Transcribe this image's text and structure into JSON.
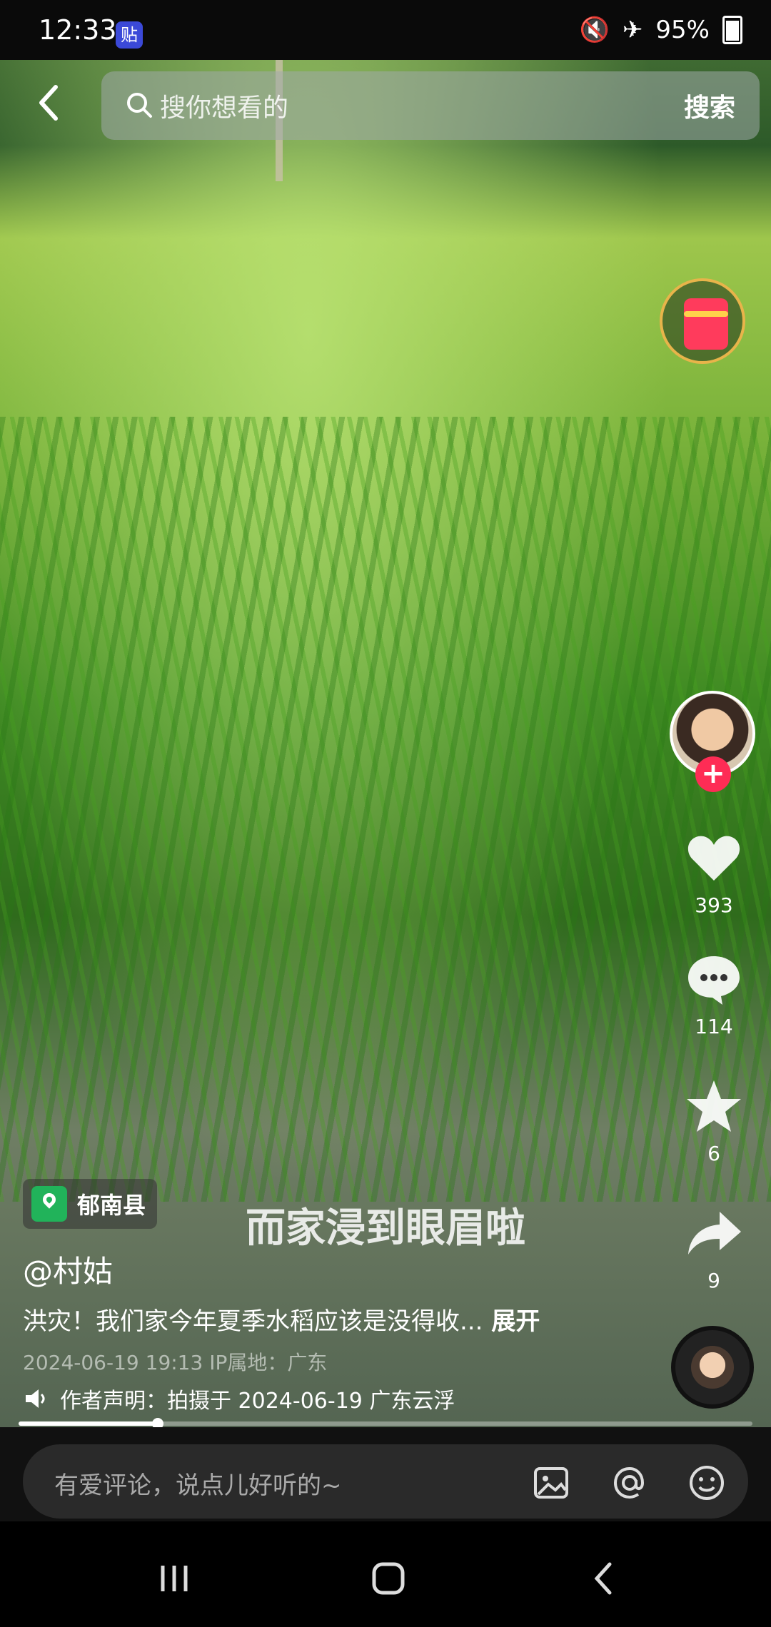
{
  "status_bar": {
    "time": "12:33",
    "app_badge": "贴",
    "battery": "95%"
  },
  "search": {
    "placeholder": "搜你想看的",
    "button": "搜索"
  },
  "video": {
    "location": "郁南县",
    "subtitle": "而家浸到眼眉啦",
    "author": "@村姑",
    "description": "洪灾！我们家今年夏季水稻应该是没得收...",
    "expand": "展开",
    "meta": "2024-06-19 19:13 IP属地：广东",
    "notice": "作者声明：拍摄于 2024-06-19 广东云浮",
    "progress_fraction": 0.19
  },
  "actions": {
    "likes": "393",
    "comments": "114",
    "favorites": "6",
    "shares": "9"
  },
  "comment_bar": {
    "placeholder": "有爱评论，说点儿好听的~"
  },
  "icons": [
    "back-icon",
    "search-icon",
    "red-envelope-icon",
    "heart-icon",
    "comment-icon",
    "star-icon",
    "share-icon",
    "location-icon",
    "speaker-icon",
    "image-icon",
    "at-icon",
    "emoji-icon",
    "recent-apps-icon",
    "home-icon",
    "nav-back-icon"
  ],
  "colors": {
    "accent": "#fe2c55",
    "location_green": "#21b35a"
  }
}
